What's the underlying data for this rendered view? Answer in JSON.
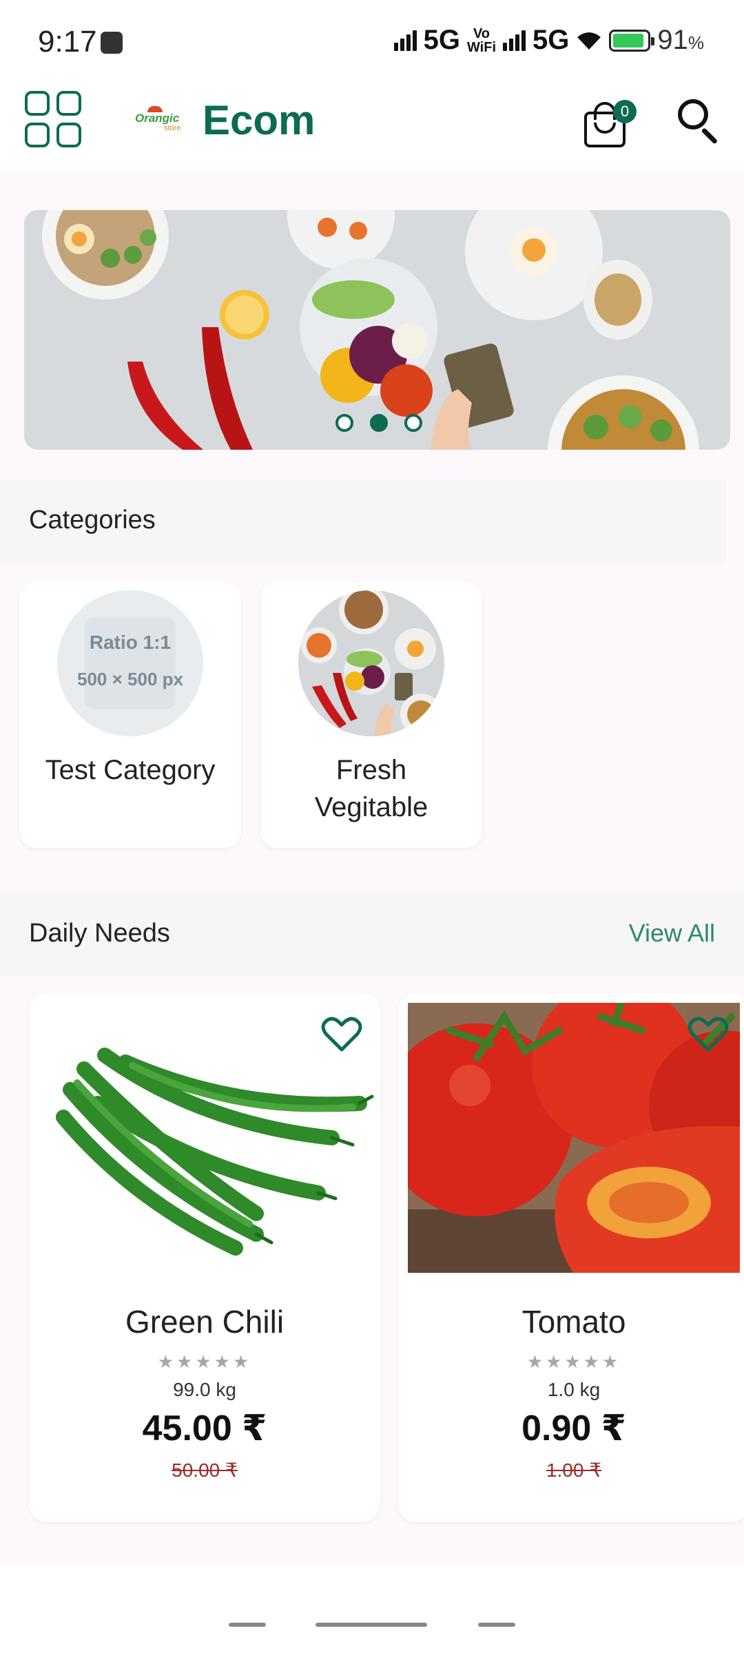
{
  "status_bar": {
    "time": "9:17",
    "network_1": "5G",
    "vowifi_top": "Vo",
    "vowifi_bottom": "WiFi",
    "network_2": "5G",
    "battery_percent": "91",
    "battery_unit": "%",
    "battery_level": 0.91
  },
  "app_bar": {
    "title": "Ecom",
    "logo_text": "Orangic",
    "logo_sub": "store",
    "cart_count": "0"
  },
  "banner": {
    "slide_count": 3,
    "active_index": 1
  },
  "categories": {
    "title": "Categories",
    "items": [
      {
        "name": "Test Category",
        "placeholder_line1": "Ratio 1:1",
        "placeholder_line2": "500 × 500 px"
      },
      {
        "name": "Fresh Vegitable"
      }
    ]
  },
  "daily_needs": {
    "title": "Daily Needs",
    "view_all": "View All",
    "products": [
      {
        "name": "Green Chili",
        "stars": "★★★★★",
        "rating": 0,
        "unit": "99.0 kg",
        "price": "45.00 ₹",
        "old_price": "50.00 ₹"
      },
      {
        "name": "Tomato",
        "stars": "★★★★★",
        "rating": 0,
        "unit": "1.0 kg",
        "price": "0.90 ₹",
        "old_price": "1.00 ₹"
      }
    ]
  },
  "colors": {
    "primary": "#0c6b50",
    "accent_link": "#2c8a64",
    "old_price": "#9b2a2a"
  }
}
